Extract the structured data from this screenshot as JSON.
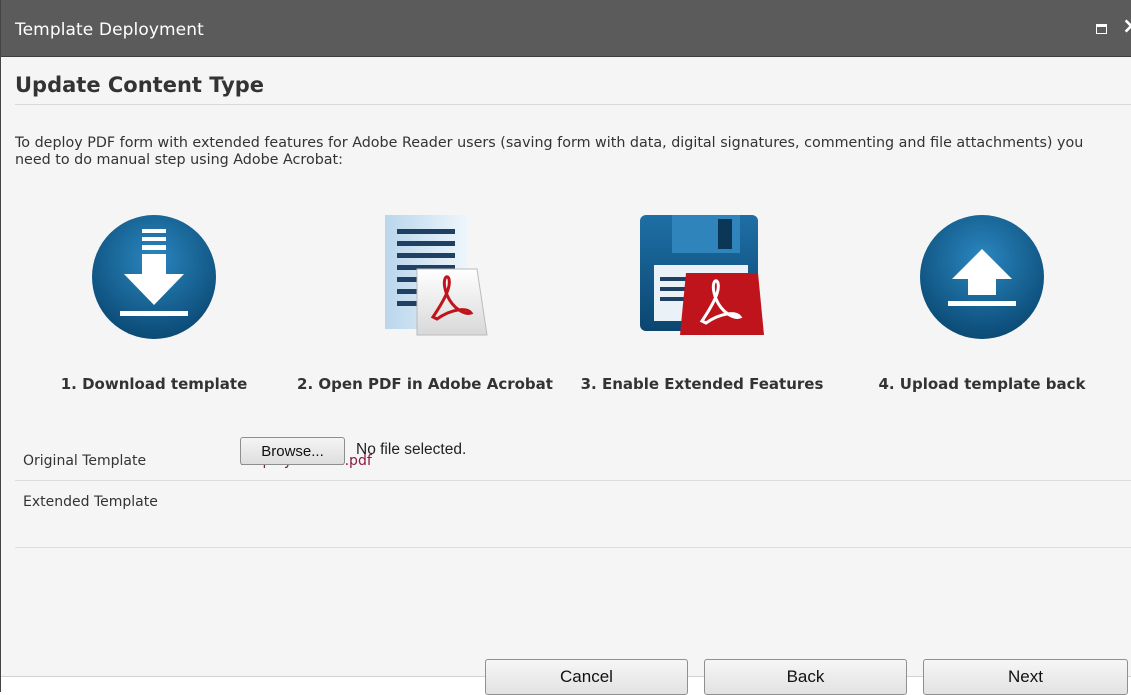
{
  "window": {
    "title": "Template Deployment",
    "maximize_icon": "maximize-icon",
    "close_icon": "close-icon"
  },
  "page": {
    "heading": "Update Content Type",
    "intro": "To deploy PDF form with extended features for Adobe Reader users (saving form with data, digital signatures, commenting and file attachments) you need to do manual step using Adobe Acrobat:"
  },
  "steps": [
    {
      "label": "1. Download template",
      "icon": "download-icon"
    },
    {
      "label": "2. Open PDF in Adobe Acrobat",
      "icon": "pdf-document-icon"
    },
    {
      "label": "3. Enable Extended Features",
      "icon": "floppy-pdf-icon"
    },
    {
      "label": "4. Upload template back",
      "icon": "upload-icon"
    }
  ],
  "form": {
    "original_label": "Original Template",
    "original_value": "EmployeeForm.pdf",
    "extended_label": "Extended Template",
    "browse_label": "Browse...",
    "no_file_text": "No file selected."
  },
  "buttons": {
    "cancel": "Cancel",
    "back": "Back",
    "next": "Next"
  },
  "colors": {
    "titlebar": "#5b5b5b",
    "step_blue": "#0f5b8a",
    "pdf_red": "#c0141c",
    "link": "#8b1a3c"
  }
}
